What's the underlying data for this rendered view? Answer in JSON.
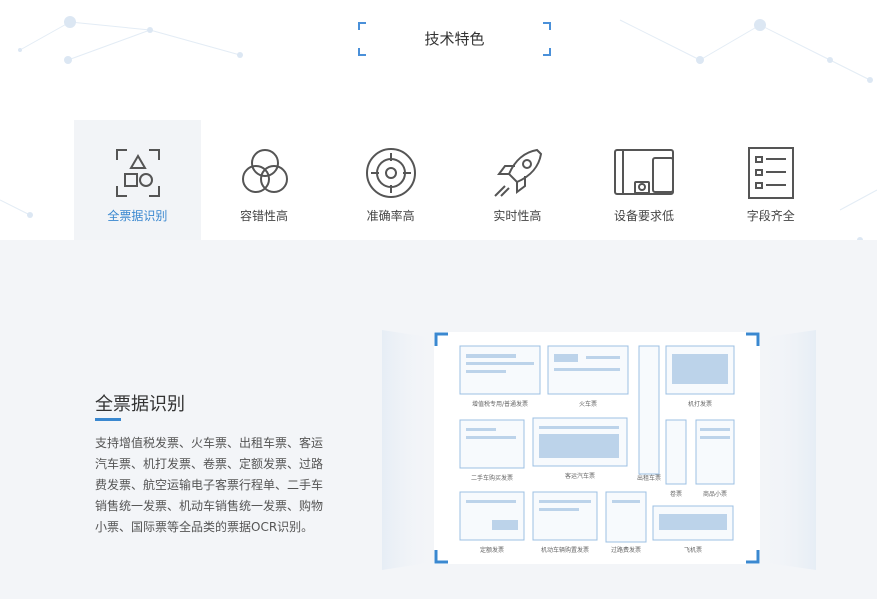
{
  "section": {
    "title": "技术特色"
  },
  "tabs": [
    {
      "label": "全票据识别",
      "icon": "ticket-shapes-icon",
      "active": true
    },
    {
      "label": "容错性高",
      "icon": "overlapping-circles-icon",
      "active": false
    },
    {
      "label": "准确率高",
      "icon": "target-icon",
      "active": false
    },
    {
      "label": "实时性高",
      "icon": "rocket-icon",
      "active": false
    },
    {
      "label": "设备要求低",
      "icon": "devices-icon",
      "active": false
    },
    {
      "label": "字段齐全",
      "icon": "list-fields-icon",
      "active": false
    }
  ],
  "detail": {
    "title": "全票据识别",
    "description": "支持增值税发票、火车票、出租车票、客运汽车票、机打发票、卷票、定额发票、过路费发票、航空运输电子客票行程单、二手车销售统一发票、机动车销售统一发票、购物小票、国际票等全品类的票据OCR识别。"
  },
  "documents": {
    "vat_invoice": "增值税专用/普通发票",
    "train_ticket": "火车票",
    "machine_invoice": "机打发票",
    "used_car_invoice": "二手车购买发票",
    "bus_ticket": "客运汽车票",
    "taxi_ticket": "出租车票",
    "roll_ticket": "卷票",
    "shopping_receipt": "商品小票",
    "quota_invoice": "定额发票",
    "vehicle_invoice": "机动车辆购置发票",
    "toll_invoice": "过路费发票",
    "air_ticket": "飞机票"
  },
  "colors": {
    "accent": "#3a88d0",
    "panel_bg": "#f3f5f8",
    "tab_active_bg": "#f2f4f7",
    "icon_stroke": "#555555"
  }
}
